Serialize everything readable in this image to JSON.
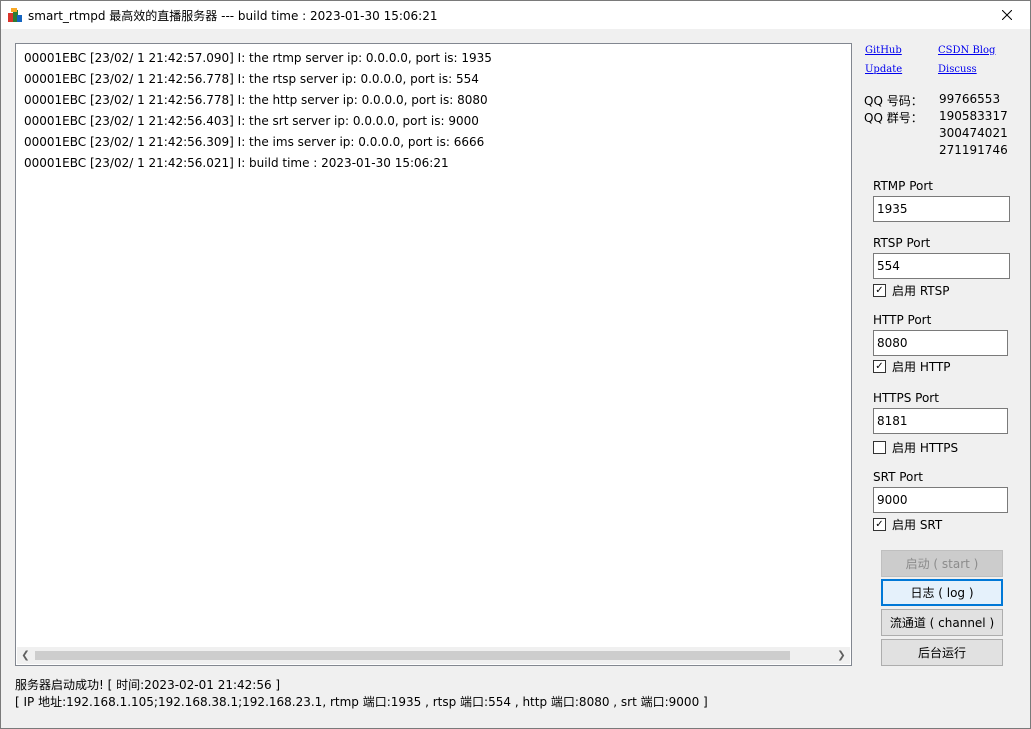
{
  "window": {
    "title": "smart_rtmpd 最高效的直播服务器 --- build time : 2023-01-30 15:06:21"
  },
  "log": {
    "lines": [
      "00001EBC [23/02/ 1 21:42:57.090] I: the rtmp server ip: 0.0.0.0, port is: 1935",
      "00001EBC [23/02/ 1 21:42:56.778] I: the rtsp server ip: 0.0.0.0, port is: 554",
      "00001EBC [23/02/ 1 21:42:56.778] I: the http server ip: 0.0.0.0, port is: 8080",
      "00001EBC [23/02/ 1 21:42:56.403] I: the srt server ip: 0.0.0.0, port is: 9000",
      "00001EBC [23/02/ 1 21:42:56.309] I: the ims server ip: 0.0.0.0, port is: 6666",
      "00001EBC [23/02/ 1 21:42:56.021] I: build time : 2023-01-30 15:06:21"
    ]
  },
  "links": {
    "github": "GitHub",
    "csdn": "CSDN Blog",
    "update": "Update",
    "discuss": "Discuss"
  },
  "qq": {
    "number_label": "QQ 号码：",
    "number_value": "99766553",
    "group_label": "QQ 群号：",
    "groups": [
      "190583317",
      "300474021",
      "271191746"
    ]
  },
  "ports": {
    "rtmp": {
      "label": "RTMP Port",
      "value": "1935"
    },
    "rtsp": {
      "label": "RTSP Port",
      "value": "554",
      "enable_label": "启用 RTSP",
      "enabled": true
    },
    "http": {
      "label": "HTTP Port",
      "value": "8080",
      "enable_label": "启用 HTTP",
      "enabled": true
    },
    "https": {
      "label": "HTTPS Port",
      "value": "8181",
      "enable_label": "启用 HTTPS",
      "enabled": false
    },
    "srt": {
      "label": "SRT Port",
      "value": "9000",
      "enable_label": "启用 SRT",
      "enabled": true
    }
  },
  "buttons": {
    "start": "启动 ( start )",
    "log": "日志 ( log )",
    "channel": "流通道 ( channel )",
    "background": "后台运行"
  },
  "status": {
    "line1": "服务器启动成功! [ 时间:2023-02-01 21:42:56 ]",
    "line2": "[ IP 地址:192.168.1.105;192.168.38.1;192.168.23.1,  rtmp 端口:1935 ,  rtsp 端口:554 ,  http 端口:8080 ,  srt 端口:9000 ]"
  },
  "icons": {
    "app": "app-icon",
    "close": "close-icon",
    "scroll_left": "chevron-left-icon",
    "scroll_right": "chevron-right-icon",
    "checkmark": "checkmark-icon"
  },
  "colors": {
    "link": "#0000ee",
    "focus_border": "#0078d7"
  }
}
